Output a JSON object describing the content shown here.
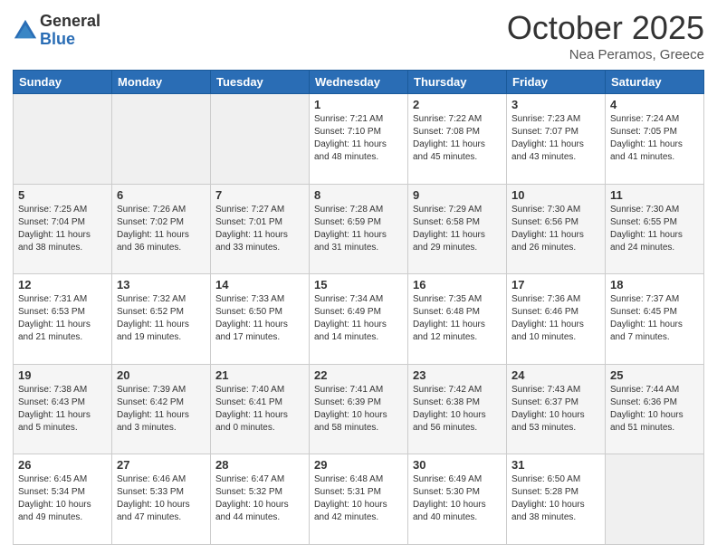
{
  "header": {
    "logo_general": "General",
    "logo_blue": "Blue",
    "month_title": "October 2025",
    "location": "Nea Peramos, Greece"
  },
  "days_of_week": [
    "Sunday",
    "Monday",
    "Tuesday",
    "Wednesday",
    "Thursday",
    "Friday",
    "Saturday"
  ],
  "weeks": [
    [
      {
        "day": "",
        "info": ""
      },
      {
        "day": "",
        "info": ""
      },
      {
        "day": "",
        "info": ""
      },
      {
        "day": "1",
        "info": "Sunrise: 7:21 AM\nSunset: 7:10 PM\nDaylight: 11 hours and 48 minutes."
      },
      {
        "day": "2",
        "info": "Sunrise: 7:22 AM\nSunset: 7:08 PM\nDaylight: 11 hours and 45 minutes."
      },
      {
        "day": "3",
        "info": "Sunrise: 7:23 AM\nSunset: 7:07 PM\nDaylight: 11 hours and 43 minutes."
      },
      {
        "day": "4",
        "info": "Sunrise: 7:24 AM\nSunset: 7:05 PM\nDaylight: 11 hours and 41 minutes."
      }
    ],
    [
      {
        "day": "5",
        "info": "Sunrise: 7:25 AM\nSunset: 7:04 PM\nDaylight: 11 hours and 38 minutes."
      },
      {
        "day": "6",
        "info": "Sunrise: 7:26 AM\nSunset: 7:02 PM\nDaylight: 11 hours and 36 minutes."
      },
      {
        "day": "7",
        "info": "Sunrise: 7:27 AM\nSunset: 7:01 PM\nDaylight: 11 hours and 33 minutes."
      },
      {
        "day": "8",
        "info": "Sunrise: 7:28 AM\nSunset: 6:59 PM\nDaylight: 11 hours and 31 minutes."
      },
      {
        "day": "9",
        "info": "Sunrise: 7:29 AM\nSunset: 6:58 PM\nDaylight: 11 hours and 29 minutes."
      },
      {
        "day": "10",
        "info": "Sunrise: 7:30 AM\nSunset: 6:56 PM\nDaylight: 11 hours and 26 minutes."
      },
      {
        "day": "11",
        "info": "Sunrise: 7:30 AM\nSunset: 6:55 PM\nDaylight: 11 hours and 24 minutes."
      }
    ],
    [
      {
        "day": "12",
        "info": "Sunrise: 7:31 AM\nSunset: 6:53 PM\nDaylight: 11 hours and 21 minutes."
      },
      {
        "day": "13",
        "info": "Sunrise: 7:32 AM\nSunset: 6:52 PM\nDaylight: 11 hours and 19 minutes."
      },
      {
        "day": "14",
        "info": "Sunrise: 7:33 AM\nSunset: 6:50 PM\nDaylight: 11 hours and 17 minutes."
      },
      {
        "day": "15",
        "info": "Sunrise: 7:34 AM\nSunset: 6:49 PM\nDaylight: 11 hours and 14 minutes."
      },
      {
        "day": "16",
        "info": "Sunrise: 7:35 AM\nSunset: 6:48 PM\nDaylight: 11 hours and 12 minutes."
      },
      {
        "day": "17",
        "info": "Sunrise: 7:36 AM\nSunset: 6:46 PM\nDaylight: 11 hours and 10 minutes."
      },
      {
        "day": "18",
        "info": "Sunrise: 7:37 AM\nSunset: 6:45 PM\nDaylight: 11 hours and 7 minutes."
      }
    ],
    [
      {
        "day": "19",
        "info": "Sunrise: 7:38 AM\nSunset: 6:43 PM\nDaylight: 11 hours and 5 minutes."
      },
      {
        "day": "20",
        "info": "Sunrise: 7:39 AM\nSunset: 6:42 PM\nDaylight: 11 hours and 3 minutes."
      },
      {
        "day": "21",
        "info": "Sunrise: 7:40 AM\nSunset: 6:41 PM\nDaylight: 11 hours and 0 minutes."
      },
      {
        "day": "22",
        "info": "Sunrise: 7:41 AM\nSunset: 6:39 PM\nDaylight: 10 hours and 58 minutes."
      },
      {
        "day": "23",
        "info": "Sunrise: 7:42 AM\nSunset: 6:38 PM\nDaylight: 10 hours and 56 minutes."
      },
      {
        "day": "24",
        "info": "Sunrise: 7:43 AM\nSunset: 6:37 PM\nDaylight: 10 hours and 53 minutes."
      },
      {
        "day": "25",
        "info": "Sunrise: 7:44 AM\nSunset: 6:36 PM\nDaylight: 10 hours and 51 minutes."
      }
    ],
    [
      {
        "day": "26",
        "info": "Sunrise: 6:45 AM\nSunset: 5:34 PM\nDaylight: 10 hours and 49 minutes."
      },
      {
        "day": "27",
        "info": "Sunrise: 6:46 AM\nSunset: 5:33 PM\nDaylight: 10 hours and 47 minutes."
      },
      {
        "day": "28",
        "info": "Sunrise: 6:47 AM\nSunset: 5:32 PM\nDaylight: 10 hours and 44 minutes."
      },
      {
        "day": "29",
        "info": "Sunrise: 6:48 AM\nSunset: 5:31 PM\nDaylight: 10 hours and 42 minutes."
      },
      {
        "day": "30",
        "info": "Sunrise: 6:49 AM\nSunset: 5:30 PM\nDaylight: 10 hours and 40 minutes."
      },
      {
        "day": "31",
        "info": "Sunrise: 6:50 AM\nSunset: 5:28 PM\nDaylight: 10 hours and 38 minutes."
      },
      {
        "day": "",
        "info": ""
      }
    ]
  ]
}
